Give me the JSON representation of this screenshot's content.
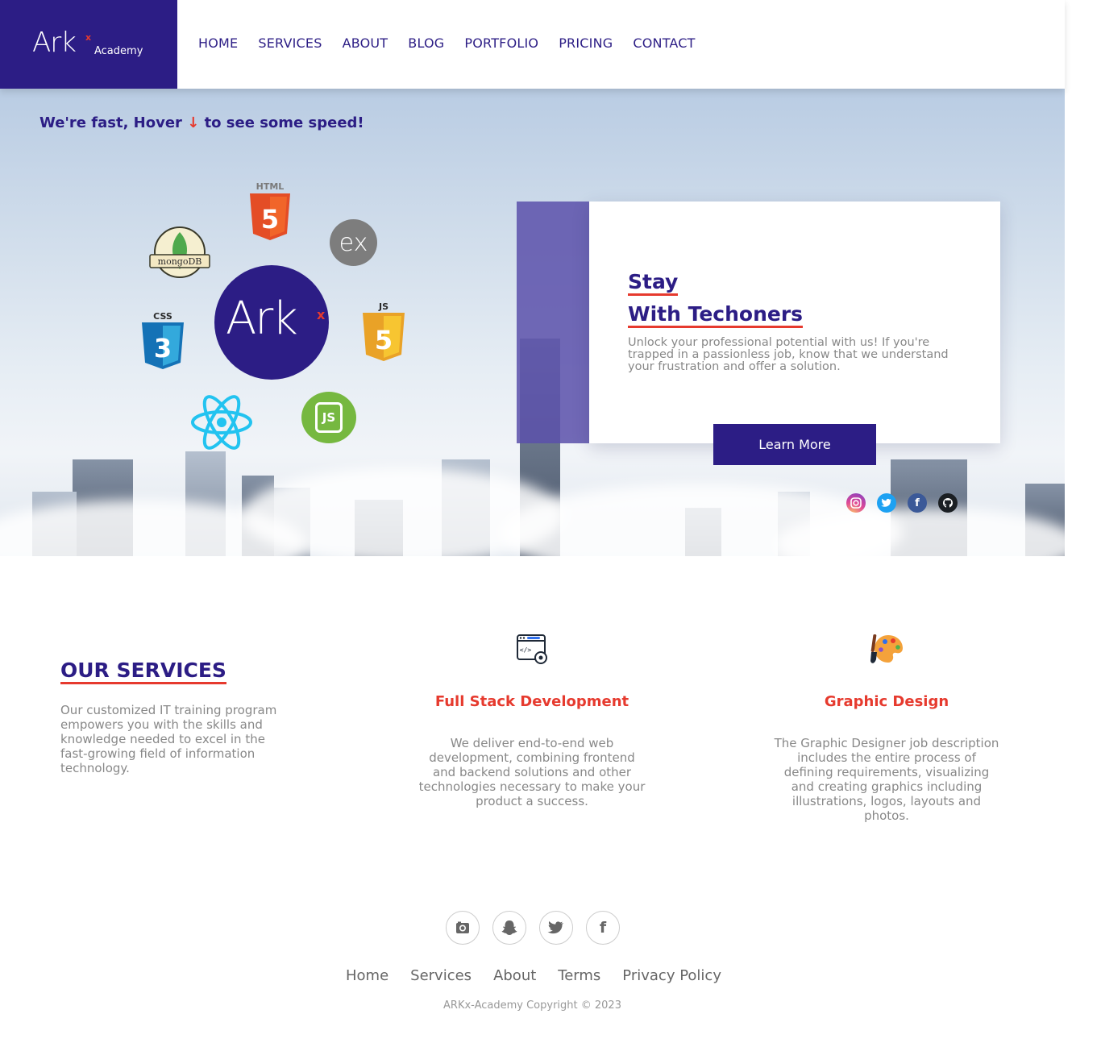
{
  "brand": {
    "name": "Ark",
    "superscript": "x",
    "subtitle": "Academy"
  },
  "nav": [
    "HOME",
    "SERVICES",
    "ABOUT",
    "BLOG",
    "PORTFOLIO",
    "PRICING",
    "CONTACT"
  ],
  "hero": {
    "speed_prefix": "We're fast, Hover ",
    "speed_arrow": "↓",
    "speed_suffix": " to see some speed!",
    "tech_icons": [
      "html5-icon",
      "express-icon",
      "mongodb-icon",
      "css3-icon",
      "javascript-icon",
      "react-icon",
      "nodejs-icon"
    ],
    "tech_labels": {
      "html": "HTML",
      "css": "CSS",
      "js": "JS",
      "express": "ex",
      "mongo": "mongoDB",
      "node": "JS"
    },
    "center_logo": {
      "name": "Ark",
      "superscript": "x"
    },
    "card": {
      "title_line1": "Stay",
      "title_line2": "With Techoners",
      "text": "Unlock your professional potential with us! If you're trapped in a passionless job, know that we understand your frustration and offer a solution.",
      "button": "Learn More"
    },
    "social": [
      "instagram-icon",
      "twitter-icon",
      "facebook-icon",
      "github-icon"
    ]
  },
  "services": {
    "title": "OUR SERVICES",
    "description": "Our customized IT training program empowers you with the skills and knowledge needed to excel in the fast-growing field of information technology.",
    "items": [
      {
        "icon": "code-settings-icon",
        "title": "Full Stack Development",
        "text": "We deliver end-to-end web development, combining frontend and backend solutions and other technologies necessary to make your product a success."
      },
      {
        "icon": "palette-icon",
        "title": "Graphic Design",
        "text": "The Graphic Designer job description includes the entire process of defining requirements, visualizing and creating graphics including illustrations, logos, layouts and photos."
      }
    ]
  },
  "footer": {
    "social": [
      "instagram-icon",
      "snapchat-icon",
      "twitter-icon",
      "facebook-icon"
    ],
    "links": [
      "Home",
      "Services",
      "About",
      "Terms",
      "Privacy Policy"
    ],
    "copyright": "ARKx-Academy Copyright © 2023"
  },
  "colors": {
    "primary": "#2c1d85",
    "accent": "#e63a2e",
    "muted": "#888888"
  }
}
